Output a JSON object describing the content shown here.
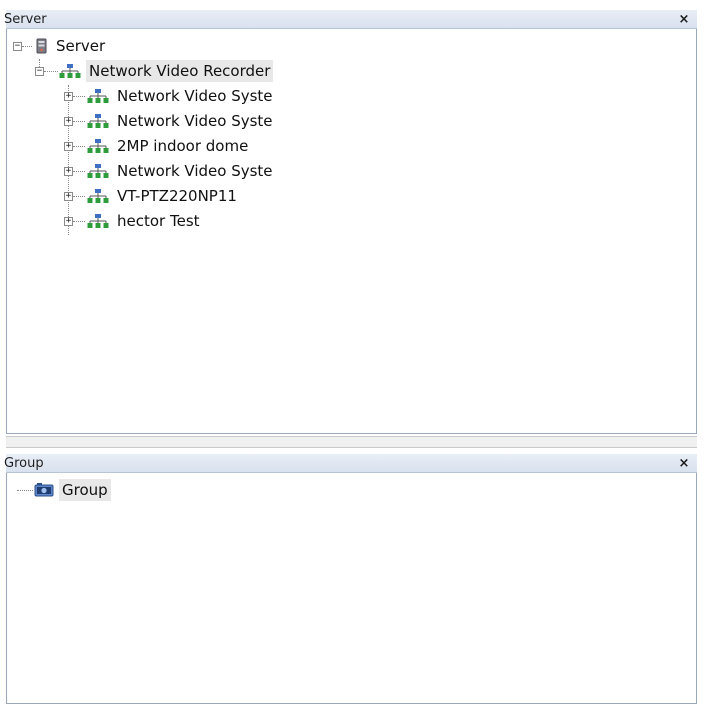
{
  "server_panel": {
    "title": "Server",
    "close_label": "×",
    "tree": {
      "root_label": "Server",
      "recorder_label": "Network Video Recorder",
      "children": [
        {
          "label": "Network Video Syste"
        },
        {
          "label": "Network Video Syste"
        },
        {
          "label": "2MP indoor dome"
        },
        {
          "label": "Network Video Syste"
        },
        {
          "label": "VT-PTZ220NP11"
        },
        {
          "label": "hector Test"
        }
      ]
    }
  },
  "group_panel": {
    "title": "Group",
    "close_label": "×",
    "tree": {
      "root_label": "Group"
    }
  },
  "icons": {
    "server": "server-icon",
    "network": "network-device-icon",
    "group": "group-camera-icon"
  }
}
